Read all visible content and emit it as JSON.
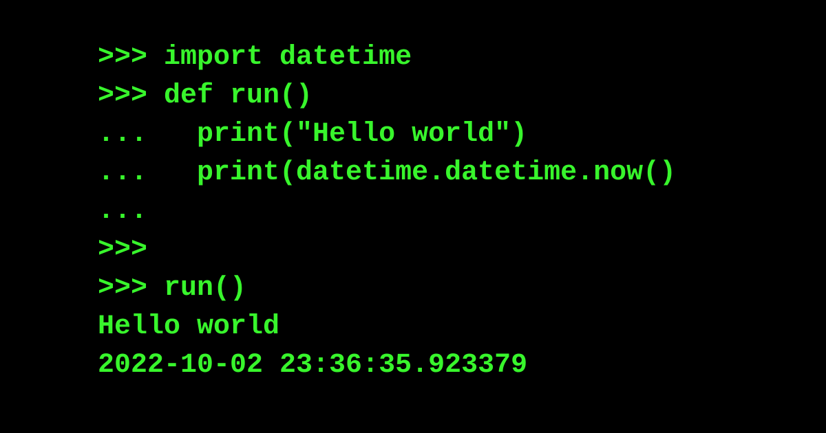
{
  "terminal": {
    "text_color": "#38f52c",
    "background_color": "#000000",
    "lines": [
      ">>> import datetime",
      ">>> def run()",
      "...   print(\"Hello world\")",
      "...   print(datetime.datetime.now()",
      "...",
      ">>>",
      ">>> run()",
      "Hello world",
      "2022-10-02 23:36:35.923379"
    ]
  }
}
